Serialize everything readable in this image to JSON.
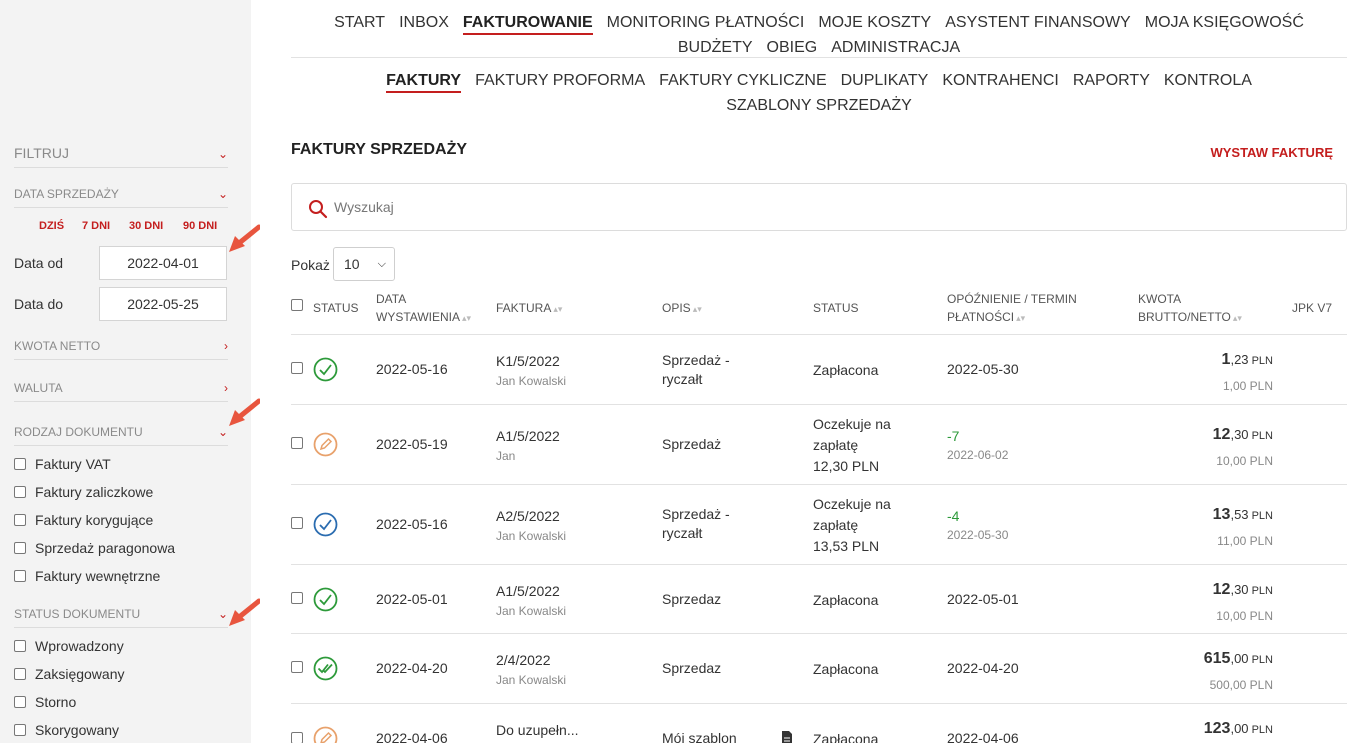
{
  "sidebar": {
    "filter_label": "FILTRUJ",
    "date_section": "DATA SPRZEDAŻY",
    "quick": [
      "DZIŚ",
      "7 DNI",
      "30 DNI",
      "90 DNI"
    ],
    "date_from_label": "Data od",
    "date_from": "2022-04-01",
    "date_to_label": "Data do",
    "date_to": "2022-05-25",
    "kwota_section": "KWOTA NETTO",
    "waluta_section": "WALUTA",
    "doc_type_section": "RODZAJ DOKUMENTU",
    "doc_types": [
      "Faktury VAT",
      "Faktury zaliczkowe",
      "Faktury korygujące",
      "Sprzedaż paragonowa",
      "Faktury wewnętrzne"
    ],
    "doc_status_section": "STATUS DOKUMENTU",
    "doc_statuses": [
      "Wprowadzony",
      "Zaksięgowany",
      "Storno",
      "Skorygowany"
    ]
  },
  "nav": {
    "main": [
      "START",
      "INBOX",
      "FAKTUROWANIE",
      "MONITORING PŁATNOŚCI",
      "MOJE KOSZTY",
      "ASYSTENT FINANSOWY",
      "MOJA KSIĘGOWOŚĆ",
      "BUDŻETY",
      "OBIEG",
      "ADMINISTRACJA"
    ],
    "sub": [
      "FAKTURY",
      "FAKTURY PROFORMA",
      "FAKTURY CYKLICZNE",
      "DUPLIKATY",
      "KONTRAHENCI",
      "RAPORTY",
      "KONTROLA",
      "SZABLONY SPRZEDAŻY"
    ]
  },
  "page": {
    "title": "FAKTURY SPRZEDAŻY",
    "issue_button": "WYSTAW FAKTURĘ",
    "search_placeholder": "Wyszukaj",
    "show_label": "Pokaż",
    "show_value": "10"
  },
  "table": {
    "headers": {
      "status": "STATUS",
      "date_1": "DATA",
      "date_2": "WYSTAWIENIA",
      "invoice": "FAKTURA",
      "desc": "OPIS",
      "status2": "STATUS",
      "delay_1": "OPÓŹNIENIE / TERMIN",
      "delay_2": "PŁATNOŚCI",
      "amount_1": "KWOTA",
      "amount_2": "BRUTTO/NETTO",
      "jpk": "JPK V7"
    },
    "rows": [
      {
        "icon": "check-circle-green",
        "date": "2022-05-16",
        "number": "K1/5/2022",
        "client": "Jan Kowalski",
        "desc1": "Sprzedaż -",
        "desc2": "ryczałt",
        "status1": "Zapłacona",
        "status2": "",
        "status3": "",
        "delay": "",
        "term": "2022-05-30",
        "gross_int": "1",
        "gross_dec": ",23",
        "currency": "PLN",
        "net": "1,00 PLN"
      },
      {
        "icon": "edit-circle-orange",
        "date": "2022-05-19",
        "number": "A1/5/2022",
        "client": "Jan",
        "desc1": "Sprzedaż",
        "desc2": "",
        "status1": "Oczekuje na",
        "status2": "zapłatę",
        "status3": "12,30 PLN",
        "delay": "-7",
        "term": "2022-06-02",
        "gross_int": "12",
        "gross_dec": ",30",
        "currency": "PLN",
        "net": "10,00 PLN"
      },
      {
        "icon": "check-circle-blue",
        "date": "2022-05-16",
        "number": "A2/5/2022",
        "client": "Jan Kowalski",
        "desc1": "Sprzedaż -",
        "desc2": "ryczałt",
        "status1": "Oczekuje na",
        "status2": "zapłatę",
        "status3": "13,53 PLN",
        "delay": "-4",
        "term": "2022-05-30",
        "gross_int": "13",
        "gross_dec": ",53",
        "currency": "PLN",
        "net": "11,00 PLN"
      },
      {
        "icon": "check-circle-green",
        "date": "2022-05-01",
        "number": "A1/5/2022",
        "client": "Jan Kowalski",
        "desc1": "Sprzedaz",
        "desc2": "",
        "status1": "Zapłacona",
        "status2": "",
        "status3": "",
        "delay": "",
        "term": "2022-05-01",
        "gross_int": "12",
        "gross_dec": ",30",
        "currency": "PLN",
        "net": "10,00 PLN"
      },
      {
        "icon": "double-check-circle-green",
        "date": "2022-04-20",
        "number": "2/4/2022",
        "client": "Jan Kowalski",
        "desc1": "Sprzedaz",
        "desc2": "",
        "status1": "Zapłacona",
        "status2": "",
        "status3": "",
        "delay": "",
        "term": "2022-04-20",
        "gross_int": "615",
        "gross_dec": ",00",
        "currency": "PLN",
        "net": "500,00 PLN"
      },
      {
        "icon": "edit-circle-orange",
        "date": "2022-04-06",
        "number": "Do uzupełn...",
        "client": "",
        "desc1": "Mój szablon",
        "desc2": "",
        "status1": "Zapłacona",
        "status2": "",
        "status3": "",
        "delay": "",
        "term": "2022-04-06",
        "gross_int": "123",
        "gross_dec": ",00",
        "currency": "PLN",
        "net": ""
      }
    ]
  },
  "colors": {
    "accent": "#c41e1e",
    "green": "#2d9a3a",
    "orange": "#e8a16b",
    "blue": "#2a6cb0"
  }
}
